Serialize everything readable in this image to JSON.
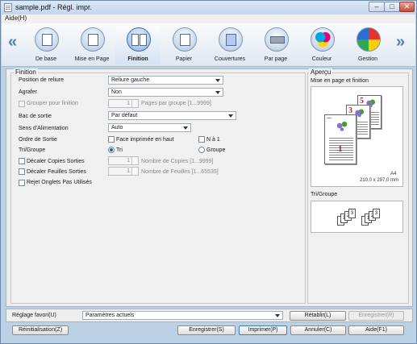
{
  "window": {
    "title": "sample.pdf - Régl. impr."
  },
  "menu": {
    "help": "Aide(H)"
  },
  "toolbar": {
    "items": [
      {
        "label": "De base",
        "icon": "basic-icon"
      },
      {
        "label": "Mise en Page",
        "icon": "layout-icon"
      },
      {
        "label": "Finition",
        "icon": "finishing-icon"
      },
      {
        "label": "Papier",
        "icon": "paper-icon"
      },
      {
        "label": "Couvertures",
        "icon": "cover-icon"
      },
      {
        "label": "Par page",
        "icon": "per-page-icon"
      },
      {
        "label": "Couleur",
        "icon": "color-icon"
      },
      {
        "label": "Gestion",
        "icon": "management-icon"
      }
    ],
    "active": "Finition"
  },
  "finition": {
    "title": "Finition",
    "binding_label": "Position de reliure",
    "binding_value": "Reliure gauche",
    "staple_label": "Agrafer",
    "staple_value": "Non",
    "group_label": "Grouper pour finition",
    "group_value": "1",
    "group_hint": "Pages par groupe [1...9999]",
    "output_tray_label": "Bac de sortie",
    "output_tray_value": "Par défaut",
    "feed_label": "Sens d'Alimentation",
    "feed_value": "Auto",
    "order_label": "Ordre de Sortie",
    "face_up_label": "Face imprimée en haut",
    "n_to_1_label": "N à 1",
    "sort_group_label": "Tri/Groupe",
    "sort_label": "Tri",
    "group_radio_label": "Groupe",
    "offset_copies_label": "Décaler Copies Sorties",
    "offset_copies_value": "1",
    "offset_copies_hint": "Nombre de Copies [1...9999]",
    "offset_sheets_label": "Décaler Feuilles Sorties",
    "offset_sheets_value": "1",
    "offset_sheets_hint": "Nombre de Feuilles [1...65535]",
    "reject_tabs_label": "Rejet Onglets Pas Utilisés"
  },
  "apercu": {
    "title": "Aperçu",
    "layout_label": "Mise en page et finition",
    "page_numbers": [
      "5",
      "3",
      "1"
    ],
    "paper_size": "A4",
    "paper_dim": "210,0 x 297,0 mm",
    "sort_group_label": "Tri/Groupe",
    "stack_labels": [
      "1",
      "2",
      "3"
    ]
  },
  "favorites": {
    "label": "Réglage favori(U)",
    "value": "Paramètres actuels",
    "restore_label": "Rétablir(L)",
    "save_label": "Enregistrer(R)"
  },
  "footer": {
    "reset_label": "Réinitialisation(Z)",
    "save_label": "Enregistrer(S)",
    "print_label": "Imprimer(P)",
    "cancel_label": "Annuler(C)",
    "help_label": "Aide(F1)"
  }
}
